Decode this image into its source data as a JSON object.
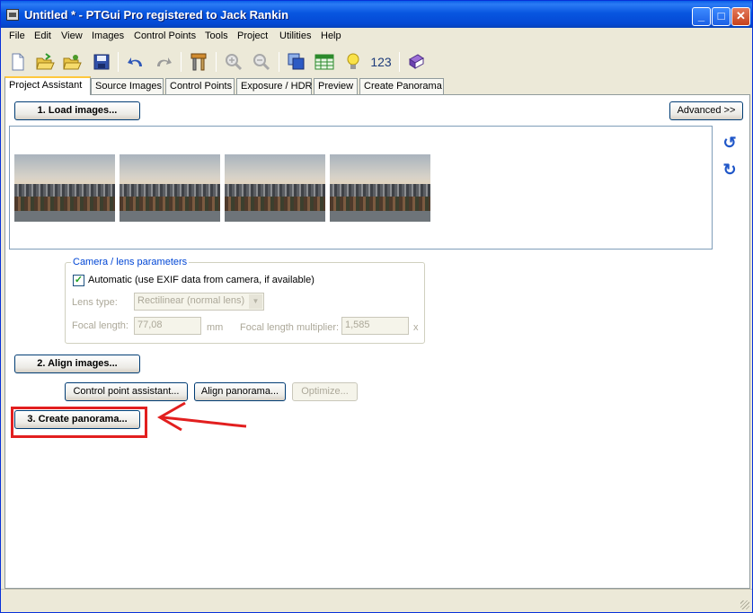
{
  "window": {
    "title": "Untitled * - PTGui Pro registered to Jack Rankin",
    "minimize": "_",
    "maximize": "□",
    "close": "✕"
  },
  "menu": [
    "File",
    "Edit",
    "View",
    "Images",
    "Control Points",
    "Tools",
    "Project",
    "Utilities",
    "Help"
  ],
  "toolbar": {
    "items": [
      "new-file-icon",
      "open-icon",
      "open-recent-icon",
      "save-icon",
      "undo-icon",
      "redo-icon",
      "tools-icon",
      "zoom-in-icon",
      "zoom-out-icon",
      "layers-icon",
      "table-icon",
      "lightbulb-icon",
      "numbers-icon",
      "book-icon"
    ],
    "numbers_label": "123"
  },
  "tabs": [
    "Project Assistant",
    "Source Images",
    "Control Points",
    "Exposure / HDR",
    "Preview",
    "Create Panorama"
  ],
  "active_tab": "Project Assistant",
  "assistant": {
    "load_button": "1. Load images...",
    "advanced_button": "Advanced >>",
    "image_count": 4,
    "camera_group": {
      "title": "Camera / lens parameters",
      "automatic_checked": true,
      "automatic_label": "Automatic (use EXIF data from camera, if available)",
      "lens_type_label": "Lens type:",
      "lens_type_value": "Rectilinear (normal lens)",
      "focal_length_label": "Focal length:",
      "focal_length_value": "77,08",
      "focal_length_unit": "mm",
      "multiplier_label": "Focal length multiplier:",
      "multiplier_value": "1,585",
      "multiplier_unit": "x"
    },
    "align_button": "2. Align images...",
    "cp_assistant_button": "Control point assistant...",
    "align_panorama_button": "Align panorama...",
    "optimize_button": "Optimize...",
    "create_button": "3. Create panorama..."
  },
  "colors": {
    "annotation": "#e21f1f",
    "titlebar": "#0856e0",
    "group_title": "#0046d5"
  }
}
